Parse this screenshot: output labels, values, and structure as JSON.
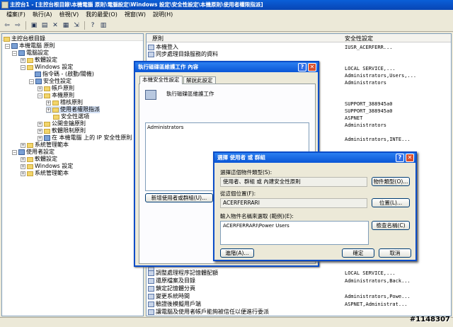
{
  "window": {
    "title": "主控台1 - [主控台根目錄\\本機電腦 原則\\電腦設定\\Windows 設定\\安全性設定\\本機原則\\使用者權限指派]"
  },
  "menu": [
    "檔案(F)",
    "執行(A)",
    "檢視(V)",
    "我的最愛(O)",
    "視窗(W)",
    "說明(H)"
  ],
  "toolbar_icons": [
    "back-icon",
    "forward-icon",
    "up-folder-icon",
    "show-tree-icon",
    "delete-icon",
    "properties-icon",
    "export-icon",
    "help-icon",
    "view-icon"
  ],
  "tree": [
    {
      "label": "主控台根目錄",
      "level": 0
    },
    {
      "label": "本機電腦 原則",
      "level": 1
    },
    {
      "label": "電腦設定",
      "level": 2
    },
    {
      "label": "軟體設定",
      "level": 3
    },
    {
      "label": "Windows 設定",
      "level": 3
    },
    {
      "label": "指令碼 - (啟動/關機)",
      "level": 4
    },
    {
      "label": "安全性設定",
      "level": 4
    },
    {
      "label": "帳戶原則",
      "level": 5
    },
    {
      "label": "本機原則",
      "level": 5
    },
    {
      "label": "稽核原則",
      "level": 6
    },
    {
      "label": "使用者權限指派",
      "level": 6,
      "selected": true
    },
    {
      "label": "安全性選項",
      "level": 6
    },
    {
      "label": "公開金鑰原則",
      "level": 5
    },
    {
      "label": "軟體限制原則",
      "level": 5
    },
    {
      "label": "在 本機電腦 上的 IP 安全性原則",
      "level": 5
    },
    {
      "label": "系統管理範本",
      "level": 3
    },
    {
      "label": "使用者設定",
      "level": 2
    },
    {
      "label": "軟體設定",
      "level": 3
    },
    {
      "label": "Windows 設定",
      "level": 3
    },
    {
      "label": "系統管理範本",
      "level": 3
    }
  ],
  "list": {
    "headers": [
      "原則",
      "安全性設定"
    ],
    "rows": [
      {
        "policy": "本機登入",
        "setting": "IUSR_ACERFERR..."
      },
      {
        "policy": "同步處理目錄服務的資料",
        "setting": ""
      },
      {
        "policy": "",
        "setting": ""
      },
      {
        "policy": "",
        "setting": "LOCAL SERVICE,..."
      },
      {
        "policy": "",
        "setting": "Administrators,Users,..."
      },
      {
        "policy": "",
        "setting": "Administrators"
      },
      {
        "policy": "",
        "setting": ""
      },
      {
        "policy": "",
        "setting": ""
      },
      {
        "policy": "",
        "setting": "SUPPORT_388945a0"
      },
      {
        "policy": "",
        "setting": "SUPPORT_388945a0"
      },
      {
        "policy": "",
        "setting": "ASPNET"
      },
      {
        "policy": "",
        "setting": "Administrators"
      },
      {
        "policy": "",
        "setting": ""
      },
      {
        "policy": "",
        "setting": "Administrators,INTE..."
      }
    ],
    "bottom_rows": [
      {
        "policy": "調整處理程序記憶體配額",
        "setting": "LOCAL SERVICE,..."
      },
      {
        "policy": "還原檔案及目錄",
        "setting": "Administrators,Back..."
      },
      {
        "policy": "鎖定記憶體分頁",
        "setting": ""
      },
      {
        "policy": "變更系統時間",
        "setting": "Administrators,Powe..."
      },
      {
        "policy": "驗證後模擬用戶端",
        "setting": "ASPNET,Administrat..."
      },
      {
        "policy": "讓電腦及使用者帳戶能夠被信任以便進行委派",
        "setting": ""
      }
    ]
  },
  "dialog_props": {
    "title": "執行磁碟區維護工作 內容",
    "tabs": [
      "本機安全性設定",
      "解說此設定"
    ],
    "heading": "執行磁碟區維護工作",
    "members": [
      "Administrators"
    ],
    "add_button": "新增使用者或群組(U)..."
  },
  "dialog_select": {
    "title": "選擇 使用者 或 群組",
    "type_label": "選擇這個物件類型(S):",
    "type_value": "使用者、群組 或 內建安全性原則",
    "type_button": "物件類型(O)...",
    "location_label": "從這個位置(F):",
    "location_value": "ACERFERRARI",
    "location_button": "位置(L)...",
    "names_label": "輸入物件名稱來選取 (範例)(E):",
    "names_value": "ACERFERRARI\\Power Users",
    "check_button": "檢查名稱(C)",
    "advanced_button": "進階(A)...",
    "ok_button": "確定",
    "cancel_button": "取消"
  },
  "watermark": "#1148307"
}
